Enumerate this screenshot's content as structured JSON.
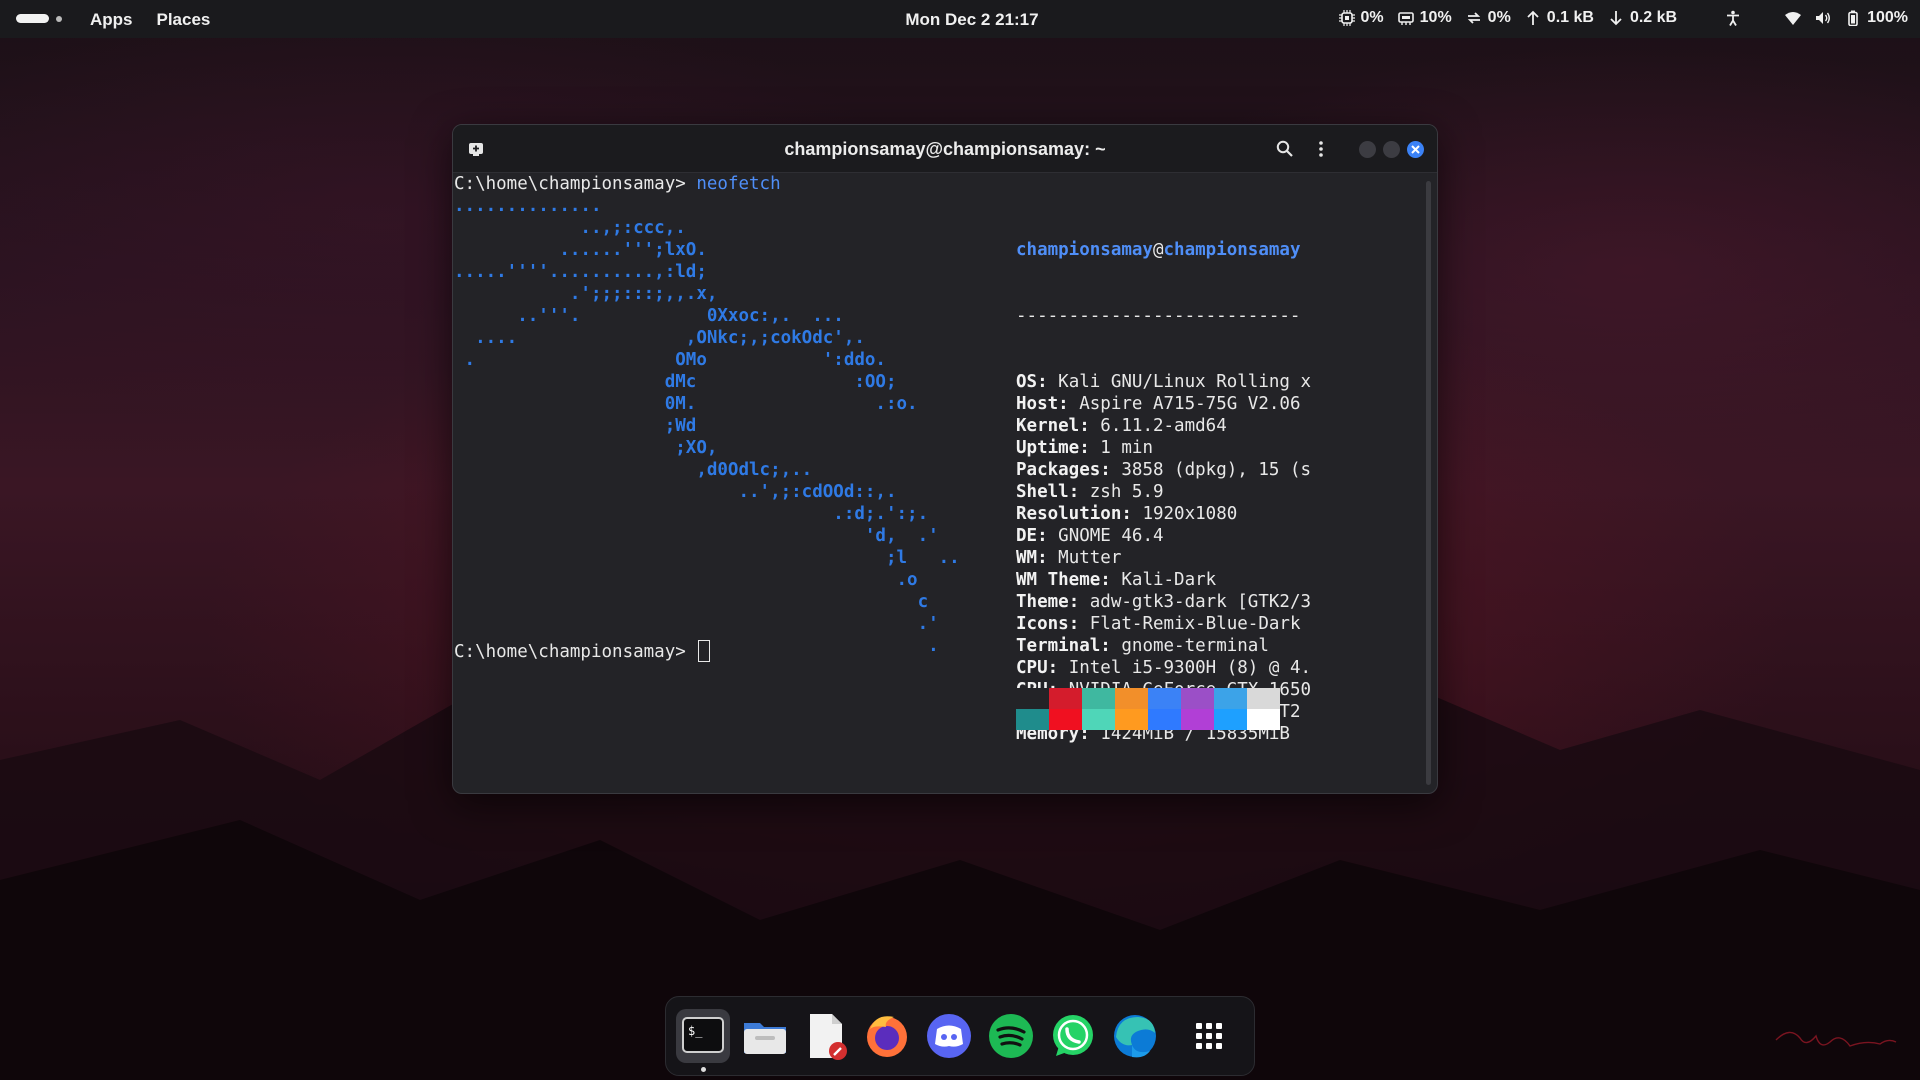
{
  "topbar": {
    "menus": [
      "Apps",
      "Places"
    ],
    "clock": "Mon Dec 2  21:17",
    "indicators": [
      {
        "icon": "cpu-icon",
        "value": "0%"
      },
      {
        "icon": "memory-icon",
        "value": "10%"
      },
      {
        "icon": "swap-icon",
        "value": "0%"
      },
      {
        "icon": "upload-icon",
        "value": "0.1 kB"
      },
      {
        "icon": "download-icon",
        "value": "0.2 kB"
      }
    ],
    "battery": "100%"
  },
  "terminal": {
    "title": "championsamay@championsamay: ~",
    "prompt": "C:\\home\\championsamay>",
    "command": "neofetch",
    "ascii_art": [
      "..............",
      "            ..,;:ccc,.",
      "          ......''';lxO.",
      ".....''''..........,:ld;",
      "           .';;;:::;,,.x,",
      "      ..'''.            0Xxoc:,.  ...",
      "  ....                ,ONkc;,;cokOdc',.",
      " .                   OMo           ':ddo.",
      "                    dMc               :OO;",
      "                    0M.                 .:o.",
      "                    ;Wd",
      "                     ;XO,",
      "                       ,d0Odlc;,..",
      "                           ..',;:cdOOd::,.",
      "                                    .:d;.':;.",
      "                                       'd,  .'",
      "                                         ;l   ..",
      "                                          .o",
      "                                            c",
      "                                            .'",
      "                                             ."
    ],
    "user": "championsamay",
    "at": "@",
    "host": "championsamay",
    "separator": "---------------------------",
    "info": [
      {
        "key": "OS",
        "value": "Kali GNU/Linux Rolling x"
      },
      {
        "key": "Host",
        "value": "Aspire A715-75G V2.06"
      },
      {
        "key": "Kernel",
        "value": "6.11.2-amd64"
      },
      {
        "key": "Uptime",
        "value": "1 min"
      },
      {
        "key": "Packages",
        "value": "3858 (dpkg), 15 (s"
      },
      {
        "key": "Shell",
        "value": "zsh 5.9"
      },
      {
        "key": "Resolution",
        "value": "1920x1080"
      },
      {
        "key": "DE",
        "value": "GNOME 46.4"
      },
      {
        "key": "WM",
        "value": "Mutter"
      },
      {
        "key": "WM Theme",
        "value": "Kali-Dark"
      },
      {
        "key": "Theme",
        "value": "adw-gtk3-dark [GTK2/3"
      },
      {
        "key": "Icons",
        "value": "Flat-Remix-Blue-Dark"
      },
      {
        "key": "Terminal",
        "value": "gnome-terminal"
      },
      {
        "key": "CPU",
        "value": "Intel i5-9300H (8) @ 4."
      },
      {
        "key": "GPU",
        "value": "NVIDIA GeForce GTX 1650"
      },
      {
        "key": "GPU",
        "value": "Intel CoffeeLake-H GT2"
      },
      {
        "key": "Memory",
        "value": "1424MiB / 15835MiB"
      }
    ],
    "palette_top": [
      "#232327",
      "#d41c2c",
      "#3fb8a0",
      "#f28f2a",
      "#3b82f6",
      "#9b4fc7",
      "#3ca3e8",
      "#d9d9d9"
    ],
    "palette_bottom": [
      "#1f8c8c",
      "#f01020",
      "#4fd6b8",
      "#ff9a1f",
      "#2f7aff",
      "#b13fd6",
      "#1ea0ff",
      "#ffffff"
    ]
  },
  "dock": {
    "items": [
      "terminal-icon",
      "files-icon",
      "text-editor-icon",
      "firefox-icon",
      "discord-icon",
      "spotify-icon",
      "whatsapp-icon",
      "edge-icon",
      "app-grid-icon"
    ]
  }
}
